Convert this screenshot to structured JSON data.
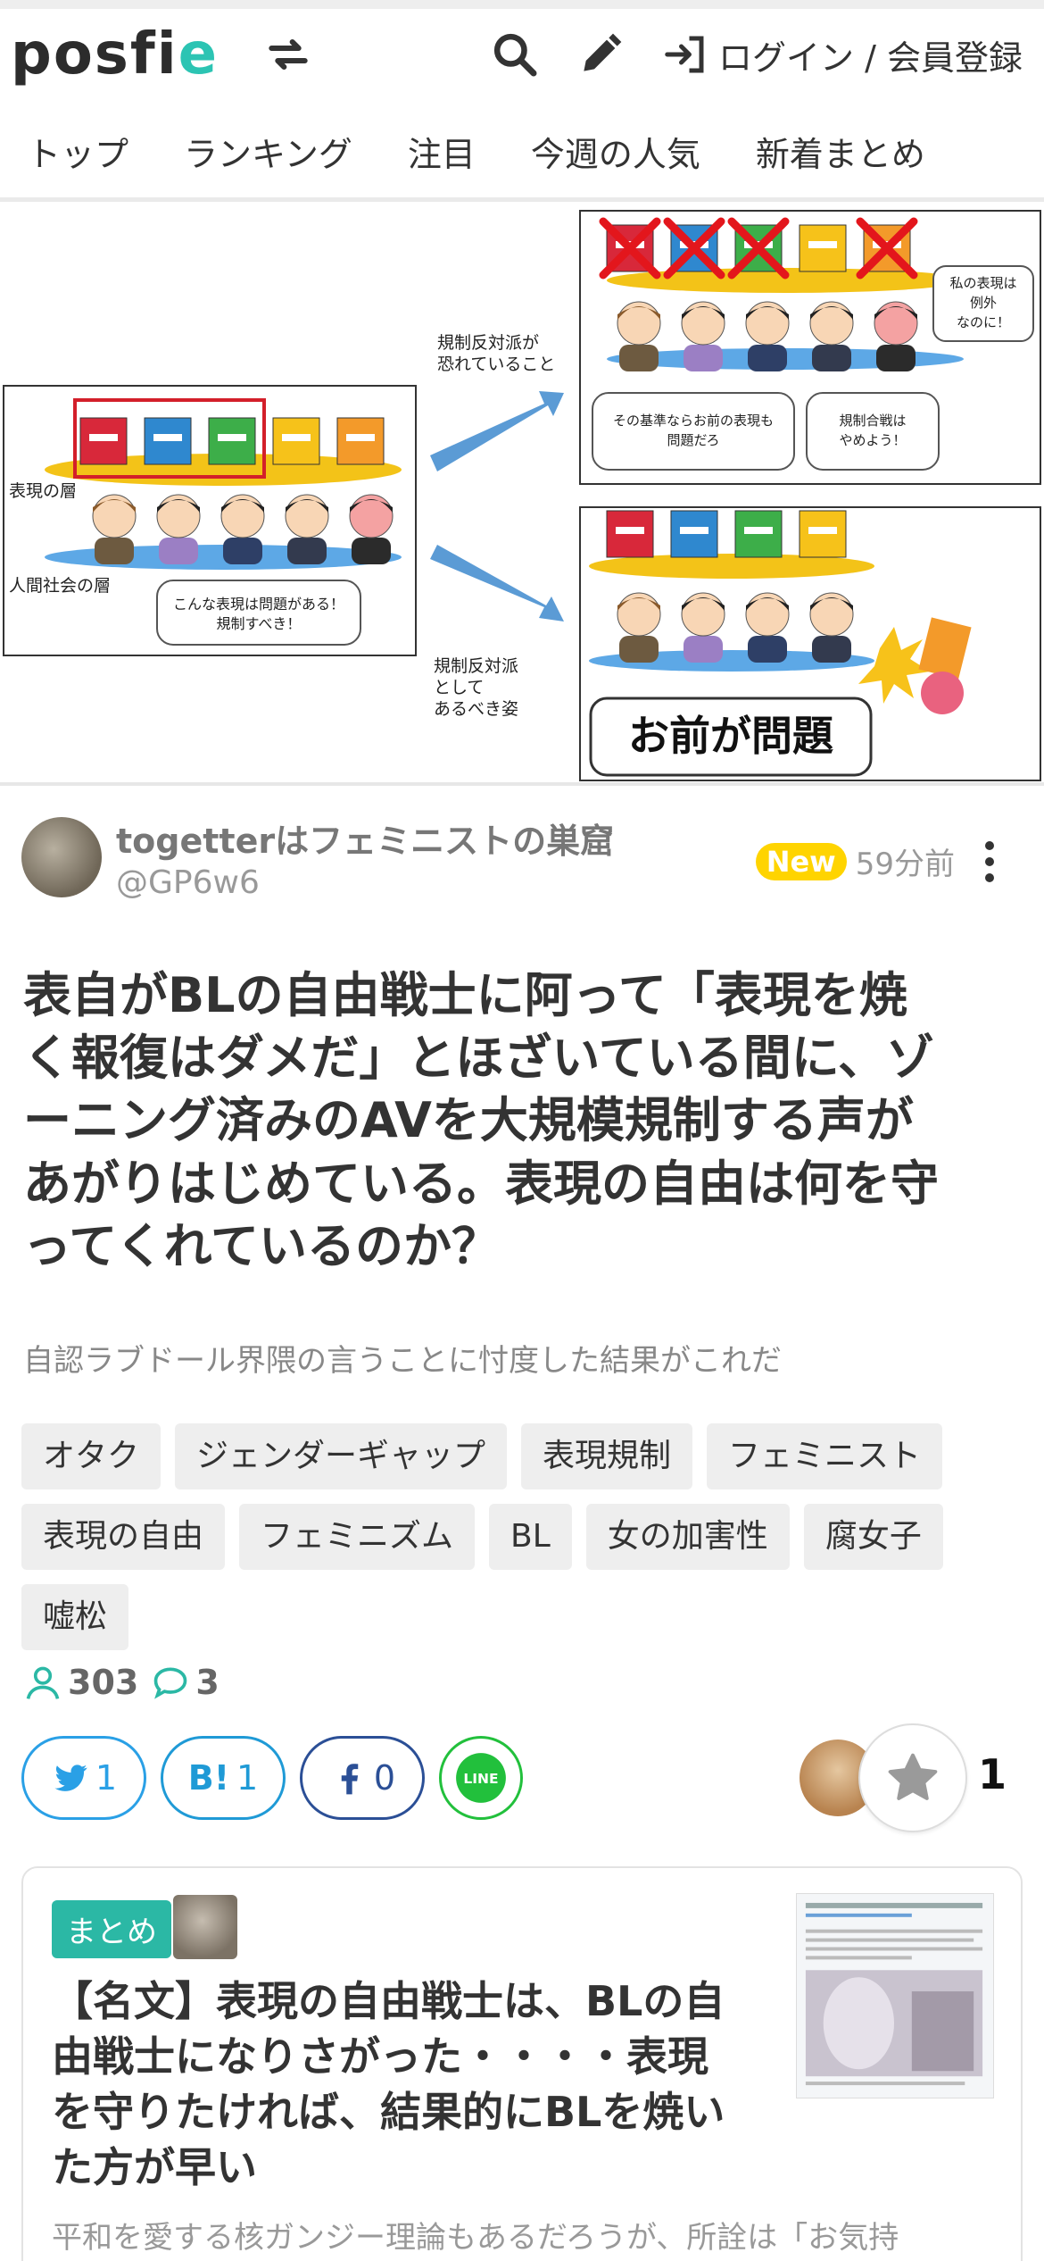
{
  "header": {
    "logo": "posfie",
    "login_label": "ログイン / 会員登録",
    "icons": [
      "logo-swap-icon",
      "search-icon",
      "pencil-icon",
      "login-icon"
    ]
  },
  "nav": {
    "items": [
      "トップ",
      "ランキング",
      "注目",
      "今週の人気",
      "新着まとめ"
    ]
  },
  "illustration": {
    "label_expression_layer": "表現の層",
    "label_society_layer": "人間社会の層",
    "label_fear_line1": "規制反対派が",
    "label_fear_line2": "恐れていること",
    "label_ideal_line1": "規制反対派",
    "label_ideal_line2": "として",
    "label_ideal_line3": "あるべき姿",
    "bubble_left_line1": "こんな表現は問題がある！",
    "bubble_left_line2": "規制すべき！",
    "bubble_top_a_line1": "その基準ならお前の表現も",
    "bubble_top_a_line2": "問題だろ",
    "bubble_top_b_line1": "規制合戦は",
    "bubble_top_b_line2": "やめよう！",
    "bubble_top_c_line1": "私の表現は",
    "bubble_top_c_line2": "例外",
    "bubble_top_c_line3": "なのに！",
    "bubble_bottom": "お前が問題",
    "book_colors": [
      "#d8283a",
      "#2f88cf",
      "#3dae49",
      "#f6c21a",
      "#f39a2a"
    ]
  },
  "post": {
    "author_name": "togetterはフェミニストの巣窟",
    "author_handle": "@GP6w6",
    "new_label": "New",
    "time": "59分前",
    "title_lines": [
      "表自がBLの自由戦士に阿って「表現を焼",
      "く報復はダメだ」とほざいている間に、ゾ",
      "ーニング済みのAVを大規模規制する声が",
      "あがりはじめている。表現の自由は何を守",
      "ってくれているのか？"
    ],
    "subtitle": "自認ラブドール界隈の言うことに忖度した結果がこれだ",
    "tags": [
      "オタク",
      "ジェンダーギャップ",
      "表現規制",
      "フェミニスト",
      "表現の自由",
      "フェミニズム",
      "BL",
      "女の加害性",
      "腐女子",
      "嘘松"
    ],
    "views": "303",
    "comments": "3"
  },
  "share": {
    "twitter_count": "1",
    "hatena_count": "1",
    "hatena_label": "B!",
    "facebook_count": "0",
    "line_label": "LINE",
    "favorites_count": "1"
  },
  "related": {
    "badge": "まとめ",
    "title_lines": [
      "【名文】表現の自由戦士は、BLの自",
      "由戦士になりさがった・・・・表現",
      "を守りたければ、結果的にBLを焼い",
      "た方が早い"
    ],
    "excerpt": "平和を愛する核ガンジー理論もあるだろうが、所詮は「お気持"
  }
}
